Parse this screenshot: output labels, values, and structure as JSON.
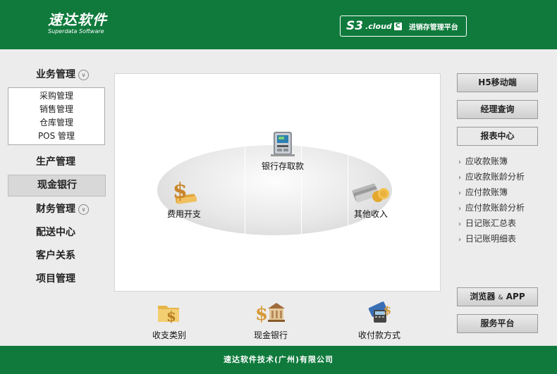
{
  "header": {
    "logo_main": "速达软件",
    "logo_sub": "Superdata Software",
    "product_s3": "S3",
    "product_cloud": ".cloud",
    "product_c": "C",
    "product_name": "进销存管理平台"
  },
  "sidebar": {
    "items": [
      {
        "label": "业务管理"
      },
      {
        "label": "生产管理"
      },
      {
        "label": "现金银行"
      },
      {
        "label": "财务管理"
      },
      {
        "label": "配送中心"
      },
      {
        "label": "客户关系"
      },
      {
        "label": "项目管理"
      }
    ],
    "sub_items": [
      {
        "label": "采购管理"
      },
      {
        "label": "销售管理"
      },
      {
        "label": "仓库管理"
      },
      {
        "label": "POS 管理"
      }
    ],
    "active_item": "现金银行"
  },
  "panel": {
    "nodes": {
      "bank": "银行存取款",
      "expense": "费用开支",
      "income": "其他收入"
    }
  },
  "bottom": {
    "items": [
      {
        "label": "收支类别"
      },
      {
        "label": "现金银行"
      },
      {
        "label": "收付款方式"
      }
    ]
  },
  "right": {
    "buttons": [
      {
        "label": "H5移动端"
      },
      {
        "label": "经理查询"
      },
      {
        "label": "报表中心"
      }
    ],
    "reports": [
      {
        "label": "应收款账簿"
      },
      {
        "label": "应收款账龄分析"
      },
      {
        "label": "应付款账簿"
      },
      {
        "label": "应付款账龄分析"
      },
      {
        "label": "日记账汇总表"
      },
      {
        "label": "日记账明细表"
      }
    ],
    "bottom_buttons": {
      "browser_a": "浏览器",
      "browser_amp": "&",
      "browser_b": "APP",
      "service": "服务平台"
    }
  },
  "footer": {
    "text": "速达软件技术(广州)有限公司"
  },
  "colors": {
    "brand_green": "#0f7a3c",
    "page_bg": "#ececec"
  }
}
